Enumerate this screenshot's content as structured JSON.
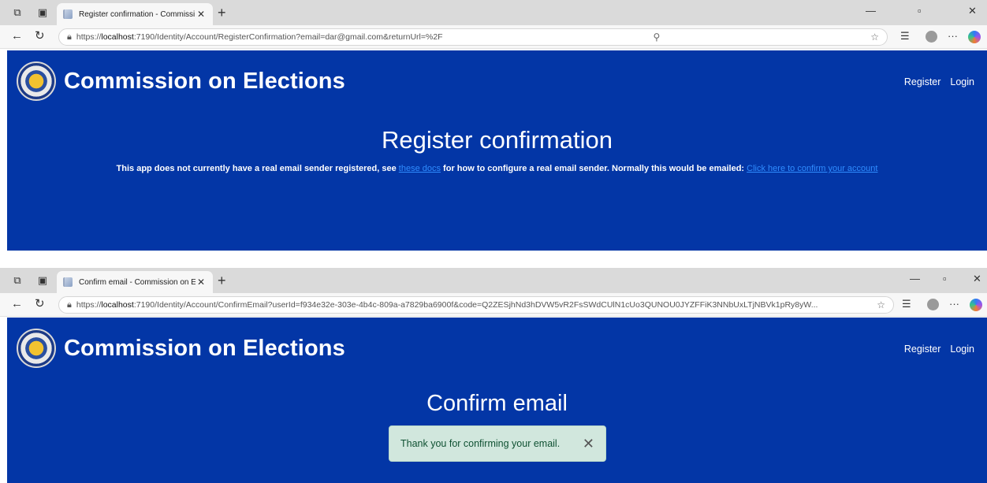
{
  "window1": {
    "tab_title": "Register confirmation - Commissi",
    "url_prefix": "https://",
    "url_host": "localhost",
    "url_rest": ":7190/Identity/Account/RegisterConfirmation?email=dar@gmail.com&returnUrl=%2F",
    "brand": "Commission on Elections",
    "nav": {
      "register": "Register",
      "login": "Login"
    },
    "heading": "Register confirmation",
    "message_before_link": "This app does not currently have a real email sender registered, see ",
    "docs_link": "these docs",
    "message_after_link": " for how to configure a real email sender. Normally this would be emailed: ",
    "confirm_link": "Click here to confirm your account"
  },
  "window2": {
    "tab_title": "Confirm email - Commission on E",
    "url_prefix": "https://",
    "url_host": "localhost",
    "url_rest": ":7190/Identity/Account/ConfirmEmail?userId=f934e32e-303e-4b4c-809a-a7829ba6900f&code=Q2ZESjhNd3hDVW5vR2FsSWdCUlN1cUo3QUNOU0JYZFFiK3NNbUxLTjNBVk1pRy8yW...",
    "brand": "Commission on Elections",
    "nav": {
      "register": "Register",
      "login": "Login"
    },
    "heading": "Confirm email",
    "alert_text": "Thank you for confirming your email."
  },
  "icons": {
    "workspaces": "workspaces-icon",
    "tab_actions": "tab-actions-icon",
    "back": "back-arrow-icon",
    "refresh": "refresh-icon",
    "lock": "lock-icon",
    "search": "search-icon",
    "favorite": "star-icon",
    "favorites": "favorites-icon",
    "profile": "profile-icon",
    "more": "more-icon",
    "copilot": "copilot-icon"
  },
  "colors": {
    "page_bg": "#0336a6",
    "link": "#2f8cff",
    "alert_bg": "#d1e7dd",
    "alert_text": "#0f5132"
  }
}
